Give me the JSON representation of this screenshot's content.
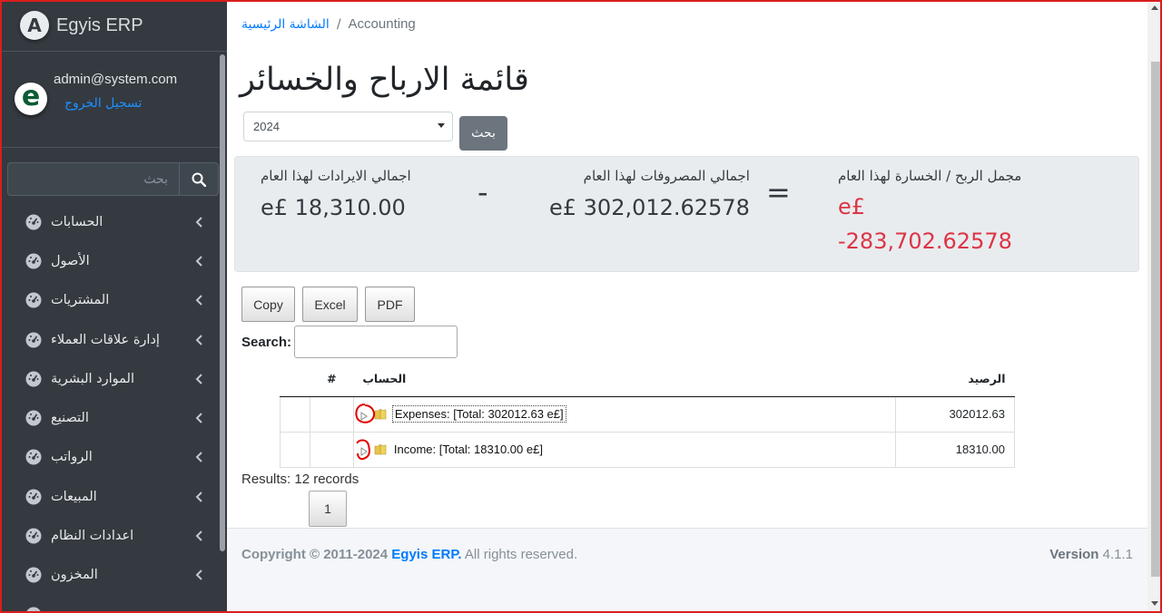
{
  "brand": {
    "name": "Egyis ERP",
    "logo_letter": "A"
  },
  "user": {
    "email": "admin@system.com",
    "logout_label": "تسجيل الخروج",
    "avatar_letter": "e"
  },
  "sidebar": {
    "search_placeholder": "بحث",
    "items": [
      {
        "label": "الحسابات"
      },
      {
        "label": "الأصول"
      },
      {
        "label": "المشتريات"
      },
      {
        "label": "إدارة علاقات العملاء"
      },
      {
        "label": "الموارد البشرية"
      },
      {
        "label": "التصنيع"
      },
      {
        "label": "الرواتب"
      },
      {
        "label": "المبيعات"
      },
      {
        "label": "اعدادات النظام"
      },
      {
        "label": "المخزون"
      }
    ]
  },
  "breadcrumb": {
    "home": "الشاشة الرئيسية",
    "separator": "/",
    "current": "Accounting"
  },
  "page": {
    "title": "قائمة الارباح والخسائر"
  },
  "filter": {
    "year": "2024",
    "search_button": "بحث"
  },
  "summary": {
    "revenue_label": "اجمالي الايرادات لهذا العام",
    "revenue_value": "e£ 18,310.00",
    "minus": "-",
    "expenses_label": "اجمالي المصروفات لهذا العام",
    "expenses_value": "e£ 302,012.62578",
    "equals": "=",
    "profit_label": "مجمل الربح / الخسارة لهذا العام",
    "profit_currency": "e£",
    "profit_value": "-283,702.62578",
    "negative_color": "#dc3545"
  },
  "table_tools": {
    "buttons": {
      "copy": "Copy",
      "excel": "Excel",
      "pdf": "PDF"
    },
    "search_label": "Search:"
  },
  "table": {
    "headers": {
      "num": "#",
      "account": "الحساب",
      "balance": "الرصيد"
    },
    "rows": [
      {
        "account": "Expenses: [Total: 302012.63 e£]",
        "balance": "302012.63"
      },
      {
        "account": "Income: [Total: 18310.00 e£]",
        "balance": "18310.00"
      }
    ]
  },
  "pagination": {
    "results": "Results: 12 records",
    "page": "1"
  },
  "footer": {
    "copyright": "Copyright © 2011-2024",
    "company": "Egyis ERP.",
    "rights": "All rights reserved.",
    "version_label": "Version",
    "version_number": "4.1.1"
  }
}
